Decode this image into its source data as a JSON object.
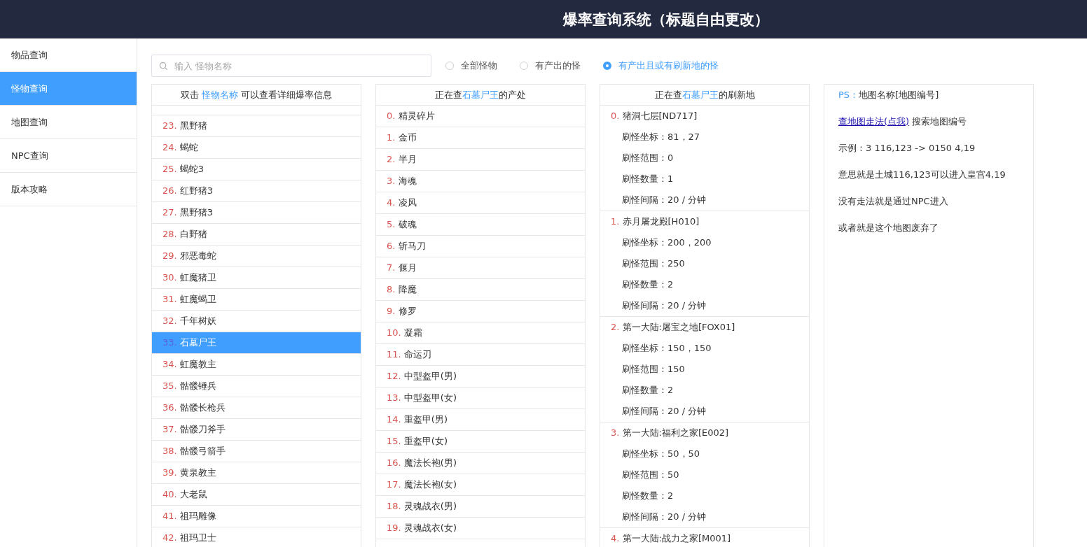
{
  "header": {
    "title": "爆率查询系统（标题自由更改）"
  },
  "sidebar": {
    "items": [
      {
        "label": "物品查询",
        "selected": false
      },
      {
        "label": "怪物查询",
        "selected": true
      },
      {
        "label": "地图查询",
        "selected": false
      },
      {
        "label": "NPC查询",
        "selected": false
      },
      {
        "label": "版本攻略",
        "selected": false
      }
    ]
  },
  "search": {
    "placeholder": "输入 怪物名称"
  },
  "filters": [
    {
      "label": "全部怪物",
      "selected": false
    },
    {
      "label": "有产出的怪",
      "selected": false
    },
    {
      "label": "有产出且或有刷新地的怪",
      "selected": true
    }
  ],
  "monsters": {
    "header": {
      "before": "双击 ",
      "highlight": "怪物名称",
      "after": " 可以查看详细爆率信息"
    },
    "rows": [
      {
        "index": "23.",
        "name": "黑野猪",
        "selected": false
      },
      {
        "index": "24.",
        "name": "蝎蛇",
        "selected": false
      },
      {
        "index": "25.",
        "name": "蝎蛇3",
        "selected": false
      },
      {
        "index": "26.",
        "name": "红野猪3",
        "selected": false
      },
      {
        "index": "27.",
        "name": "黑野猪3",
        "selected": false
      },
      {
        "index": "28.",
        "name": "白野猪",
        "selected": false
      },
      {
        "index": "29.",
        "name": "邪恶毒蛇",
        "selected": false
      },
      {
        "index": "30.",
        "name": "虹魔猪卫",
        "selected": false
      },
      {
        "index": "31.",
        "name": "虹魔蝎卫",
        "selected": false
      },
      {
        "index": "32.",
        "name": "千年树妖",
        "selected": false
      },
      {
        "index": "33.",
        "name": "石墓尸王",
        "selected": true
      },
      {
        "index": "34.",
        "name": "虹魔教主",
        "selected": false
      },
      {
        "index": "35.",
        "name": "骷髅锤兵",
        "selected": false
      },
      {
        "index": "36.",
        "name": "骷髅长枪兵",
        "selected": false
      },
      {
        "index": "37.",
        "name": "骷髅刀斧手",
        "selected": false
      },
      {
        "index": "38.",
        "name": "骷髅弓箭手",
        "selected": false
      },
      {
        "index": "39.",
        "name": "黄泉教主",
        "selected": false
      },
      {
        "index": "40.",
        "name": "大老鼠",
        "selected": false
      },
      {
        "index": "41.",
        "name": "祖玛雕像",
        "selected": false
      },
      {
        "index": "42.",
        "name": "祖玛卫士",
        "selected": false
      }
    ]
  },
  "drops": {
    "header": {
      "before": "正在查",
      "highlight": "石墓尸王",
      "after": "的产处"
    },
    "rows": [
      {
        "index": "0.",
        "name": "精灵碎片"
      },
      {
        "index": "1.",
        "name": "金币"
      },
      {
        "index": "2.",
        "name": "半月"
      },
      {
        "index": "3.",
        "name": "海魂"
      },
      {
        "index": "4.",
        "name": "凌风"
      },
      {
        "index": "5.",
        "name": "破魂"
      },
      {
        "index": "6.",
        "name": "斩马刀"
      },
      {
        "index": "7.",
        "name": "偃月"
      },
      {
        "index": "8.",
        "name": "降魔"
      },
      {
        "index": "9.",
        "name": "修罗"
      },
      {
        "index": "10.",
        "name": "凝霜"
      },
      {
        "index": "11.",
        "name": "命运刃"
      },
      {
        "index": "12.",
        "name": "中型盔甲(男)"
      },
      {
        "index": "13.",
        "name": "中型盔甲(女)"
      },
      {
        "index": "14.",
        "name": "重盔甲(男)"
      },
      {
        "index": "15.",
        "name": "重盔甲(女)"
      },
      {
        "index": "16.",
        "name": "魔法长袍(男)"
      },
      {
        "index": "17.",
        "name": "魔法长袍(女)"
      },
      {
        "index": "18.",
        "name": "灵魂战衣(男)"
      },
      {
        "index": "19.",
        "name": "灵魂战衣(女)"
      }
    ]
  },
  "spawns": {
    "header": {
      "before": "正在查",
      "highlight": "石墓尸王",
      "after": "的刷新地"
    },
    "entries": [
      {
        "index": "0.",
        "name": "猪洞七层[ND717]",
        "details": [
          "刷怪坐标：81，27",
          "刷怪范围：0",
          "刷怪数量：1",
          "刷怪间隔：20 / 分钟"
        ]
      },
      {
        "index": "1.",
        "name": "赤月屠龙殿[H010]",
        "details": [
          "刷怪坐标：200，200",
          "刷怪范围：250",
          "刷怪数量：2",
          "刷怪间隔：20 / 分钟"
        ]
      },
      {
        "index": "2.",
        "name": "第一大陆:屠宝之地[FOX01]",
        "details": [
          "刷怪坐标：150，150",
          "刷怪范围：150",
          "刷怪数量：2",
          "刷怪间隔：20 / 分钟"
        ]
      },
      {
        "index": "3.",
        "name": "第一大陆:福利之家[E002]",
        "details": [
          "刷怪坐标：50，50",
          "刷怪范围：50",
          "刷怪数量：2",
          "刷怪间隔：20 / 分钟"
        ]
      },
      {
        "index": "4.",
        "name": "第一大陆:战力之家[M001]"
      }
    ]
  },
  "notes": {
    "ps_label": "PS：",
    "ps_text": "地图名称[地图编号]",
    "link": "查地图走法(点我)",
    "link_after": " 搜索地图编号",
    "lines": [
      "示例：3 116,123 -> 0150 4,19",
      "意思就是土城116,123可以进入皇宫4,19",
      "没有走法就是通过NPC进入",
      "或者就是这个地图废弃了"
    ]
  }
}
